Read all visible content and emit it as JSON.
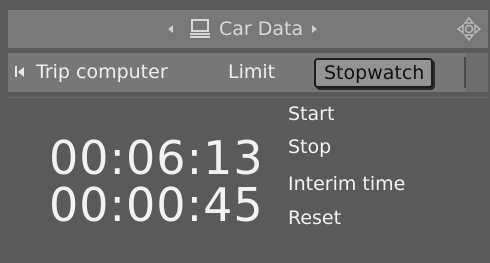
{
  "header": {
    "title": "Car Data",
    "icons": [
      "nav-left-small",
      "computer-icon",
      "nav-right-small",
      "controller-joystick-icon"
    ]
  },
  "menu": {
    "tabs": [
      {
        "label": "Trip computer",
        "selected": false
      },
      {
        "label": "Limit",
        "selected": false
      },
      {
        "label": "Stopwatch",
        "selected": true
      }
    ]
  },
  "stopwatch": {
    "time_main": "00:06:13",
    "time_interim": "00:00:45",
    "actions": [
      "Start",
      "Stop",
      "Interim time",
      "Reset"
    ]
  }
}
